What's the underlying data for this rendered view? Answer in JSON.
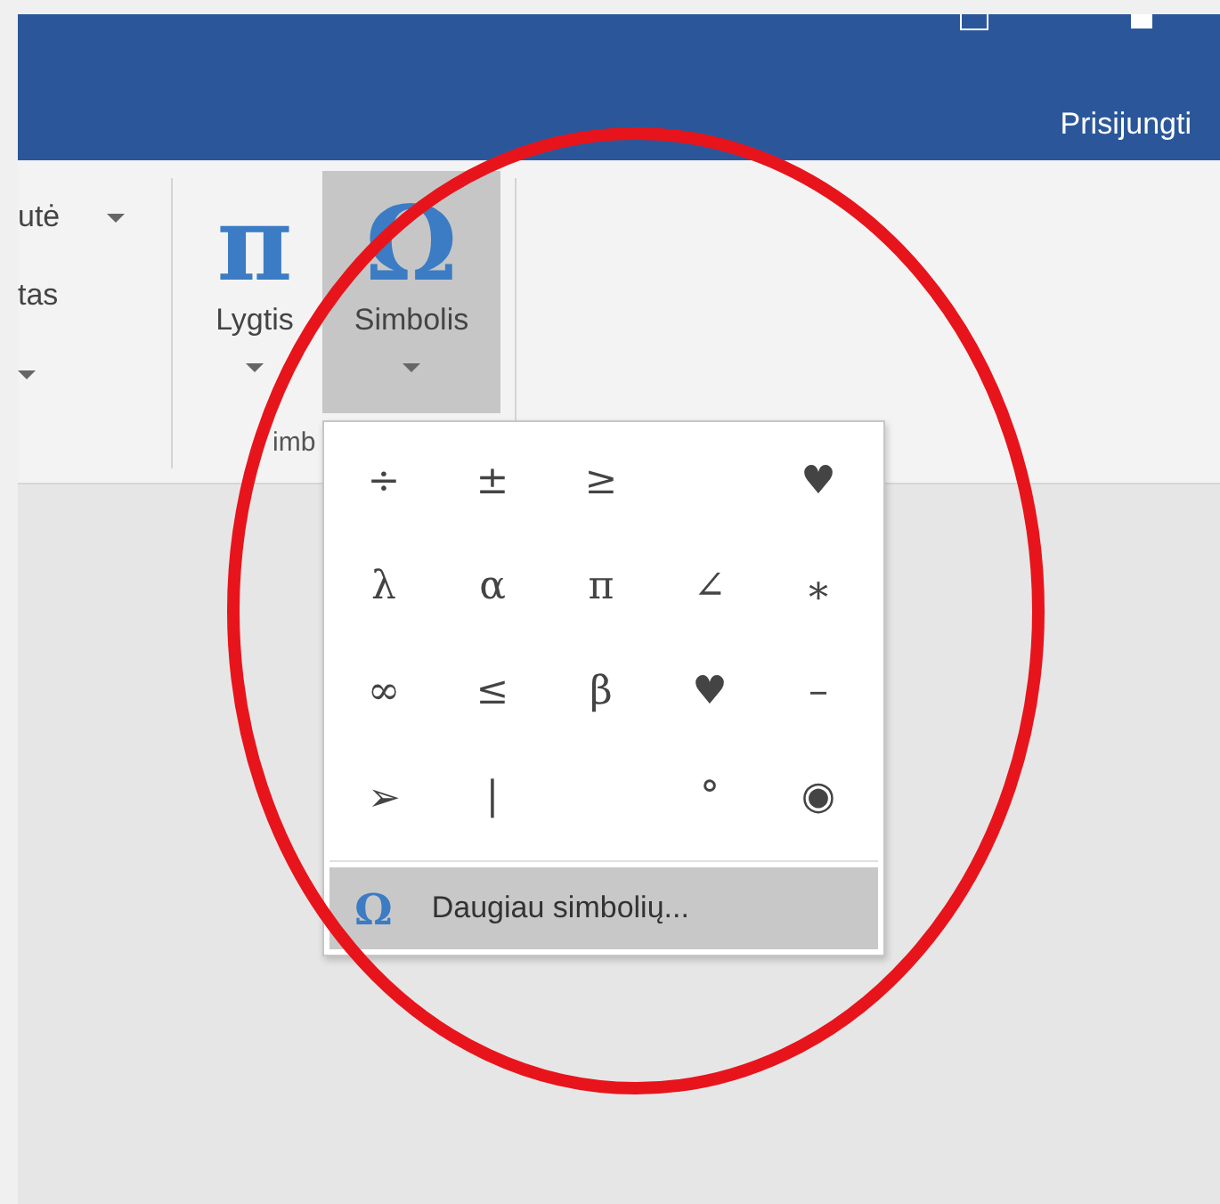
{
  "title_bar": {
    "sign_in": "Prisijungti"
  },
  "ribbon": {
    "partial_group": {
      "items": [
        {
          "label": "utė",
          "has_caret": true
        },
        {
          "label": "tas",
          "has_caret": false
        },
        {
          "has_caret": true
        }
      ]
    },
    "buttons": [
      {
        "label": "Lygtis",
        "glyph": "π",
        "selected": false
      },
      {
        "label": "Simbolis",
        "glyph": "Ω",
        "selected": true
      }
    ],
    "group_label": "imb"
  },
  "symbol_menu": {
    "cells": [
      {
        "kind": "symbol",
        "symbol": "÷"
      },
      {
        "kind": "symbol",
        "symbol": "±"
      },
      {
        "kind": "symbol",
        "symbol": "≥"
      },
      {
        "kind": "empty"
      },
      {
        "kind": "symbol",
        "symbol": "♥"
      },
      {
        "kind": "symbol",
        "symbol": "λ"
      },
      {
        "kind": "symbol",
        "symbol": "α"
      },
      {
        "kind": "symbol",
        "symbol": "π"
      },
      {
        "kind": "symbol",
        "symbol": "∠"
      },
      {
        "kind": "symbol",
        "symbol": "⁎"
      },
      {
        "kind": "symbol",
        "symbol": "∞"
      },
      {
        "kind": "symbol",
        "symbol": "≤"
      },
      {
        "kind": "symbol",
        "symbol": "β"
      },
      {
        "kind": "symbol",
        "symbol": "♥"
      },
      {
        "kind": "symbol",
        "symbol": "–"
      },
      {
        "kind": "symbol",
        "symbol": "➢"
      },
      {
        "kind": "symbol",
        "symbol": "|"
      },
      {
        "kind": "empty"
      },
      {
        "kind": "symbol",
        "symbol": "°"
      },
      {
        "kind": "symbol",
        "symbol": "◉"
      }
    ],
    "more_item": {
      "glyph": "Ω",
      "label": "Daugiau simbolių...",
      "selected": true
    }
  }
}
